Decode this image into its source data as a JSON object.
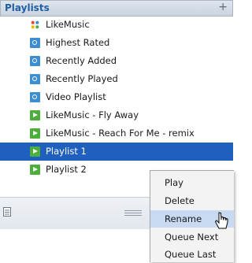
{
  "header": {
    "title": "Playlists",
    "add_symbol": "+"
  },
  "list": [
    {
      "label": "LikeMusic",
      "icon": "likemusic-logo-icon"
    },
    {
      "label": "Highest Rated",
      "icon": "smart-playlist-icon"
    },
    {
      "label": "Recently Added",
      "icon": "smart-playlist-icon"
    },
    {
      "label": "Recently Played",
      "icon": "smart-playlist-icon"
    },
    {
      "label": "Video Playlist",
      "icon": "smart-playlist-icon"
    },
    {
      "label": "LikeMusic - Fly Away",
      "icon": "playlist-icon"
    },
    {
      "label": "LikeMusic - Reach For Me - remix",
      "icon": "playlist-icon"
    },
    {
      "label": "Playlist 1",
      "icon": "playlist-icon",
      "selected": true
    },
    {
      "label": "Playlist 2",
      "icon": "playlist-icon"
    }
  ],
  "context_menu": {
    "items": [
      "Play",
      "Delete",
      "Rename",
      "Queue Next",
      "Queue Last"
    ],
    "hovered": "Rename"
  },
  "colors": {
    "selection": "#1f5fbd",
    "header_title": "#1f5fa6",
    "menu_hover": "#c7daf2"
  }
}
